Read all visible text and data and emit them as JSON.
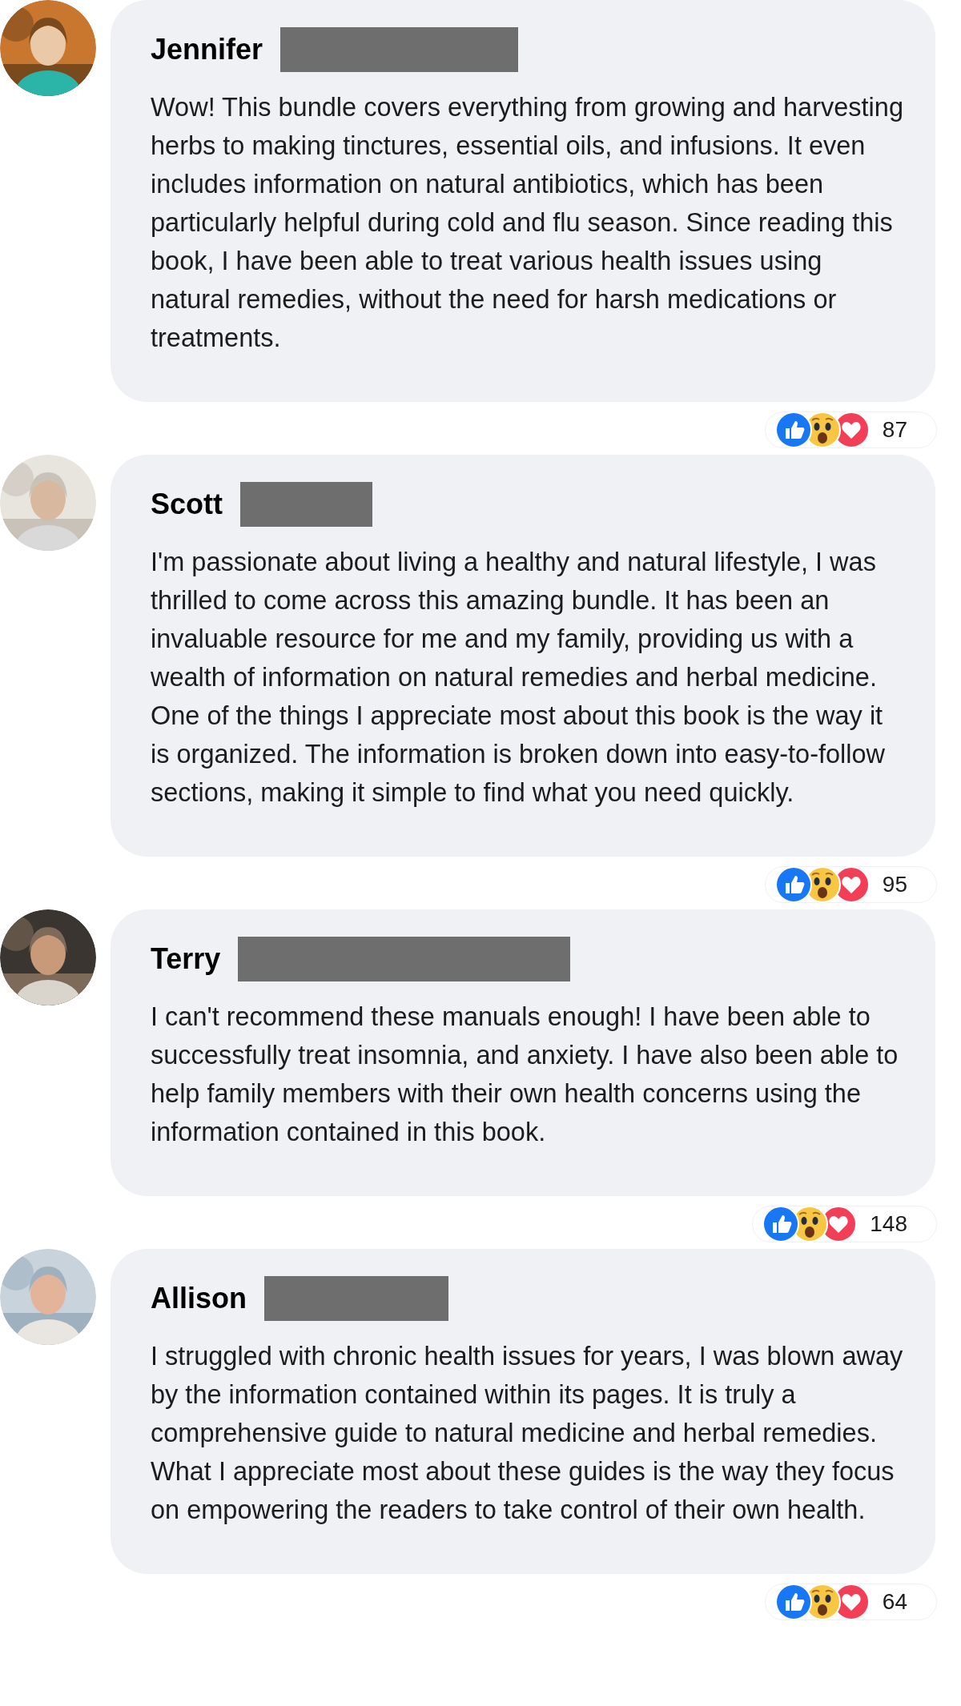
{
  "comments": [
    {
      "name": "Jennifer",
      "text": "Wow! This bundle covers everything from growing and harvesting herbs to making tinctures, essential oils, and infusions. It even includes information on natural antibiotics, which has been particularly helpful during cold and flu season. Since reading this book, I have been able to treat various health issues using natural remedies, without the need for harsh medications or treatments.",
      "reaction_count": "87"
    },
    {
      "name": "Scott",
      "text": "I'm passionate about living a healthy and natural lifestyle, I was thrilled to come across this amazing bundle. It has been an invaluable resource for me and my family, providing us with a wealth of information on natural remedies and herbal medicine. One of the things I appreciate most about this book is the way it is organized. The information is broken down into easy-to-follow sections, making it simple to find what you need quickly.",
      "reaction_count": "95"
    },
    {
      "name": "Terry",
      "text": "I can't recommend these manuals enough! I have been able to successfully treat insomnia, and anxiety. I have also been able to help family members with their own health concerns using the information contained in this book.",
      "reaction_count": "148"
    },
    {
      "name": "Allison",
      "text": "I struggled with chronic health issues for years, I was blown away by the information contained within its pages. It is truly a comprehensive guide to natural medicine and herbal remedies. What I appreciate most about these guides is the way they focus on empowering the readers to take control of their own health.",
      "reaction_count": "64"
    }
  ]
}
